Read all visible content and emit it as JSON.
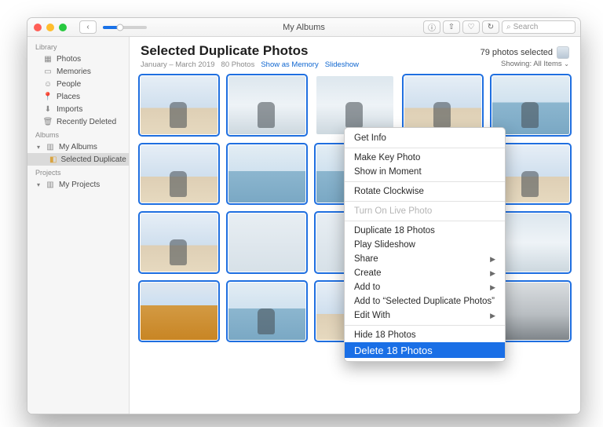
{
  "window": {
    "title": "My Albums"
  },
  "toolbar": {
    "search_placeholder": "Search"
  },
  "sidebar": {
    "groups": {
      "library": "Library",
      "albums": "Albums",
      "projects": "Projects"
    },
    "library_items": [
      {
        "label": "Photos"
      },
      {
        "label": "Memories"
      },
      {
        "label": "People"
      },
      {
        "label": "Places"
      },
      {
        "label": "Imports"
      },
      {
        "label": "Recently Deleted"
      }
    ],
    "albums_items": [
      {
        "label": "My Albums"
      },
      {
        "label": "Selected Duplicate Photos",
        "selected": true
      }
    ],
    "projects_items": [
      {
        "label": "My Projects"
      }
    ]
  },
  "header": {
    "title": "Selected Duplicate Photos",
    "date_range": "January – March 2019",
    "count_label": "80 Photos",
    "show_as_memory": "Show as Memory",
    "slideshow": "Slideshow",
    "selected_label": "79 photos selected",
    "showing_label": "Showing:",
    "showing_value": "All Items"
  },
  "context_menu": {
    "get_info": "Get Info",
    "make_key": "Make Key Photo",
    "show_in_moment": "Show in Moment",
    "rotate": "Rotate Clockwise",
    "live_photo": "Turn On Live Photo",
    "duplicate": "Duplicate 18 Photos",
    "play_slideshow": "Play Slideshow",
    "share": "Share",
    "create": "Create",
    "add_to": "Add to",
    "add_to_album": "Add to “Selected Duplicate Photos”",
    "edit_with": "Edit With",
    "hide": "Hide 18 Photos",
    "delete": "Delete 18 Photos"
  }
}
